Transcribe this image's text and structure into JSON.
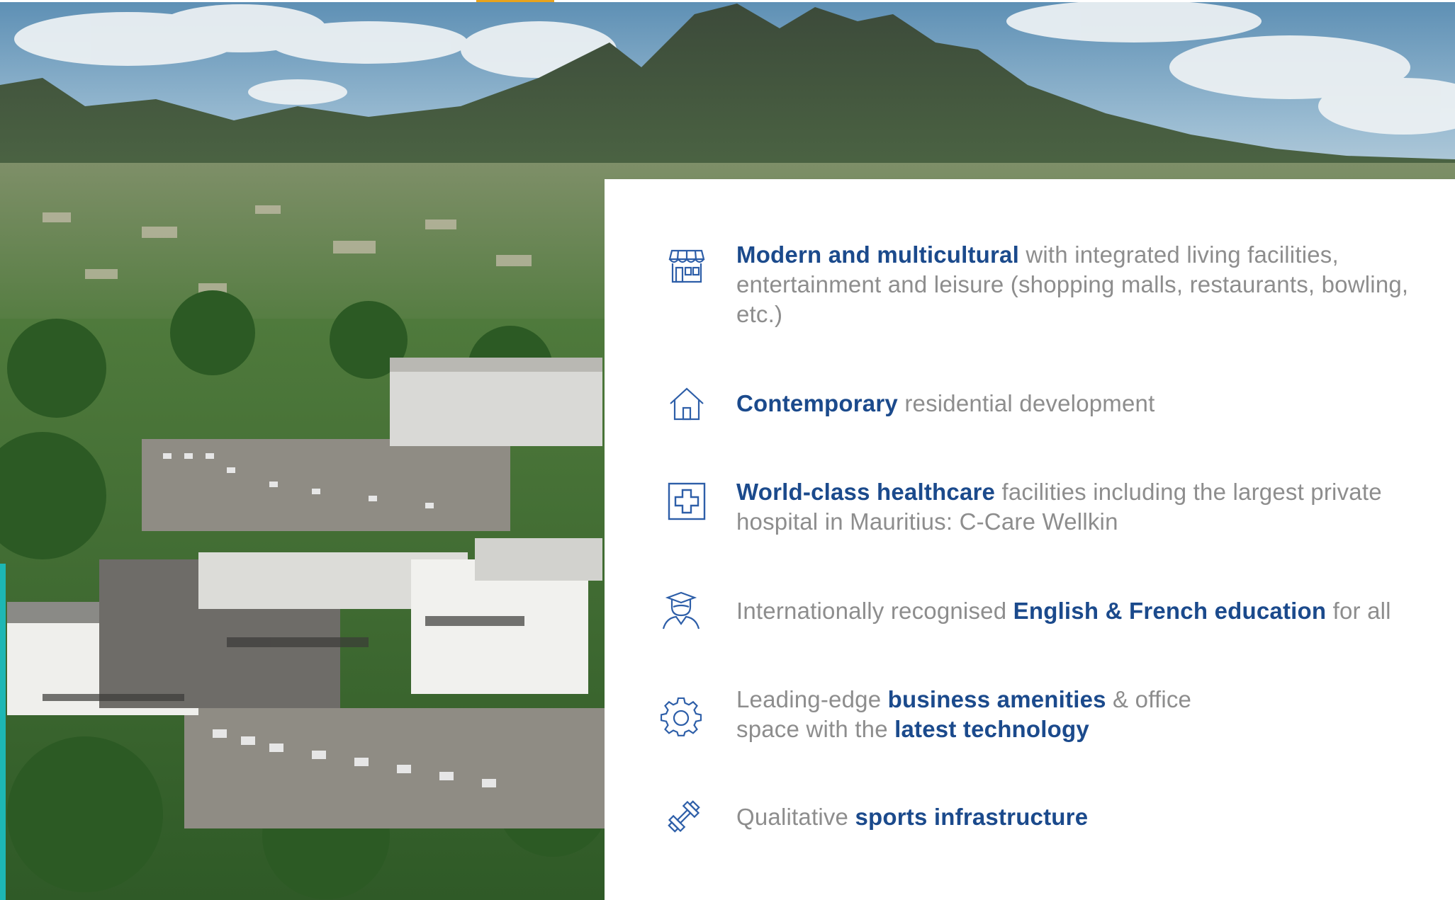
{
  "colors": {
    "accent_blue": "#1b4a8c",
    "body_grey": "#8d8d8d",
    "icon_blue": "#2d5ea8",
    "teal_bar": "#1db7b4",
    "orange_bar": "#e8a31d"
  },
  "image": {
    "icon": "aerial-landscape-photo"
  },
  "features": [
    {
      "icon": "storefront-icon",
      "parts": [
        {
          "bold": "Modern and multicultural"
        },
        {
          "text": " with integrated living facilities, entertainment and leisure  (shopping malls, restaurants, bowling, etc.)"
        }
      ]
    },
    {
      "icon": "house-icon",
      "parts": [
        {
          "bold": "Contemporary"
        },
        {
          "text": " residential development"
        }
      ]
    },
    {
      "icon": "medical-cross-icon",
      "parts": [
        {
          "bold": "World-class healthcare"
        },
        {
          "text": " facilities including the largest private hospital in Mauritius: C-Care Wellkin"
        }
      ]
    },
    {
      "icon": "graduate-icon",
      "parts": [
        {
          "text": "Internationally recognised "
        },
        {
          "bold": "English & French education"
        },
        {
          "text": " for all"
        }
      ]
    },
    {
      "icon": "gear-icon",
      "parts": [
        {
          "text": "Leading-edge "
        },
        {
          "bold": "business amenities"
        },
        {
          "text": " & office space with the "
        },
        {
          "bold": "latest technology"
        }
      ]
    },
    {
      "icon": "dumbbell-icon",
      "parts": [
        {
          "text": "Qualitative "
        },
        {
          "bold": "sports infrastructure"
        }
      ]
    }
  ]
}
